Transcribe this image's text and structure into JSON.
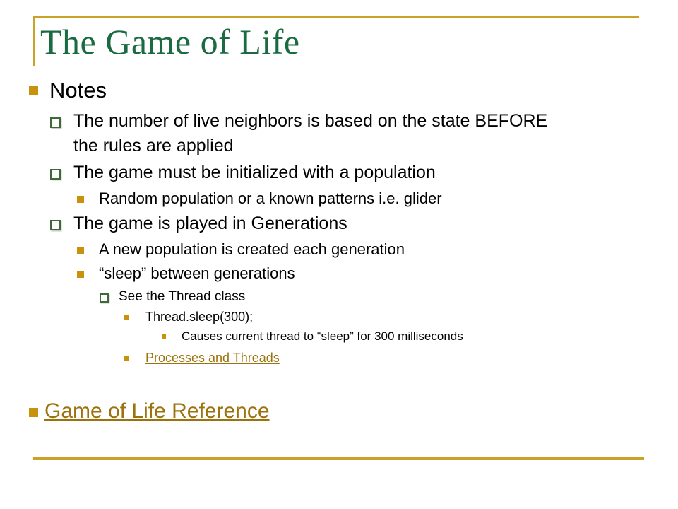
{
  "slide": {
    "title": "The Game of Life",
    "theme": {
      "accent_gold": "#C9A227",
      "bullet_gold": "#C9920C",
      "bullet_green": "#3E6B35",
      "title_green": "#1A6B42",
      "link_brown": "#9C720D",
      "text_black": "#000000",
      "background": "#FFFFFF"
    },
    "outline": [
      {
        "level": 1,
        "marker": "gold-solid-square",
        "text": "Notes"
      },
      {
        "level": 2,
        "marker": "green-hollow-square",
        "text": "The number of live neighbors is based on the state BEFORE the rules are applied"
      },
      {
        "level": 2,
        "marker": "green-hollow-square",
        "text": "The game must be initialized with a population"
      },
      {
        "level": 3,
        "marker": "gold-solid-square",
        "text": "Random population or a known patterns i.e. glider"
      },
      {
        "level": 2,
        "marker": "green-hollow-square",
        "text": "The game is played in Generations"
      },
      {
        "level": 3,
        "marker": "gold-solid-square",
        "text": "A new population is created each generation"
      },
      {
        "level": 3,
        "marker": "gold-solid-square",
        "text": "“sleep” between generations"
      },
      {
        "level": 4,
        "marker": "green-hollow-square",
        "text": "See the Thread class"
      },
      {
        "level": 5,
        "marker": "gold-small-square",
        "text": "Thread.sleep(300);"
      },
      {
        "level": 6,
        "marker": "gold-small-square",
        "text": "Causes current thread to “sleep” for 300 milliseconds"
      },
      {
        "level": 5,
        "marker": "gold-small-square",
        "text": "Processes and Threads",
        "is_link": true
      },
      {
        "level": 1,
        "marker": "gold-solid-square",
        "text": " Game of Life Reference",
        "is_link": true
      }
    ]
  }
}
